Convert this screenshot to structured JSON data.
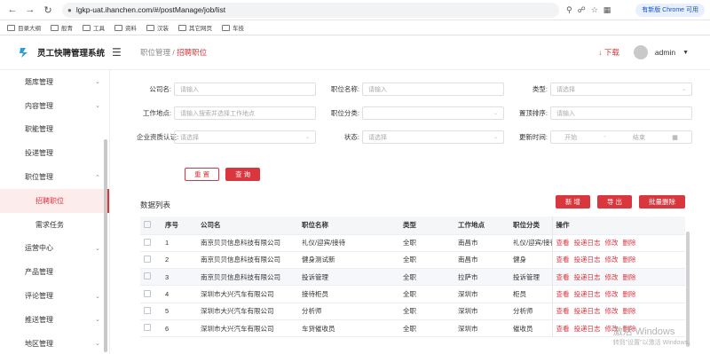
{
  "browser": {
    "url": "lgkp-uat.ihanchen.com/#/postManage/job/list",
    "update_label": "有新版 Chrome 可用",
    "bookmarks": [
      "目录大纲",
      "般青",
      "工具",
      "资料",
      "汉装",
      "其它网页",
      "车技"
    ]
  },
  "app": {
    "title": "灵工快聘管理系统",
    "breadcrumb_parent": "职位管理",
    "breadcrumb_sep": " / ",
    "breadcrumb_current": "招聘职位",
    "download_label": "下载",
    "user_name": "admin"
  },
  "sidebar": {
    "items": [
      {
        "label": "题库管理"
      },
      {
        "label": "内容管理"
      },
      {
        "label": "职能管理"
      },
      {
        "label": "投递管理"
      },
      {
        "label": "职位管理"
      },
      {
        "label": "招聘职位"
      },
      {
        "label": "需求任务"
      },
      {
        "label": "运营中心"
      },
      {
        "label": "产品管理"
      },
      {
        "label": "评论管理"
      },
      {
        "label": "推送管理"
      },
      {
        "label": "地区管理"
      }
    ]
  },
  "filters": {
    "company_label": "公司名:",
    "company_placeholder": "请输入",
    "job_name_label": "职位名称:",
    "job_name_placeholder": "请输入",
    "type_label": "类型:",
    "type_placeholder": "请选择",
    "location_label": "工作地点:",
    "location_placeholder": "请输入搜索并选择工作地点",
    "category_label": "职位分类:",
    "category_placeholder": "",
    "sort_label": "置顶排序:",
    "sort_placeholder": "请输入",
    "cert_label": "企业资质认证:",
    "cert_placeholder": "请选择",
    "status_label": "状态:",
    "status_placeholder": "请选择",
    "update_label": "更新时间:",
    "date_start": "开始",
    "date_sep": "-",
    "date_end": "结束"
  },
  "actions": {
    "reset_label": "重 置",
    "search_label": "查 询"
  },
  "list": {
    "title": "数据列表",
    "add_label": "新 增",
    "export_label": "导 出",
    "batch_delete_label": "批量删除",
    "columns": [
      "序号",
      "公司名",
      "职位名称",
      "类型",
      "工作地点",
      "职位分类",
      "操作"
    ],
    "ops": [
      "查看",
      "投递日志",
      "修改",
      "删除"
    ],
    "rows": [
      {
        "no": "1",
        "company": "南京贝贝信息科技有限公司",
        "job": "礼仪/迎宾/接待",
        "type": "全职",
        "city": "南昌市",
        "category": "礼仪/迎宾/接待"
      },
      {
        "no": "2",
        "company": "南京贝贝信息科技有限公司",
        "job": "健身测试新",
        "type": "全职",
        "city": "南昌市",
        "category": "健身"
      },
      {
        "no": "3",
        "company": "南京贝贝信息科技有限公司",
        "job": "投诉管理",
        "type": "全职",
        "city": "拉萨市",
        "category": "投诉管理"
      },
      {
        "no": "4",
        "company": "深圳市大兴汽车有限公司",
        "job": "接待柜员",
        "type": "全职",
        "city": "深圳市",
        "category": "柜员"
      },
      {
        "no": "5",
        "company": "深圳市大兴汽车有限公司",
        "job": "分析师",
        "type": "全职",
        "city": "深圳市",
        "category": "分析师"
      },
      {
        "no": "6",
        "company": "深圳市大兴汽车有限公司",
        "job": "车贷催收员",
        "type": "全职",
        "city": "深圳市",
        "category": "催收员"
      }
    ]
  },
  "os_watermark": {
    "line1": "激活 Windows",
    "line2": "转到\"设置\"以激活 Windows。"
  }
}
